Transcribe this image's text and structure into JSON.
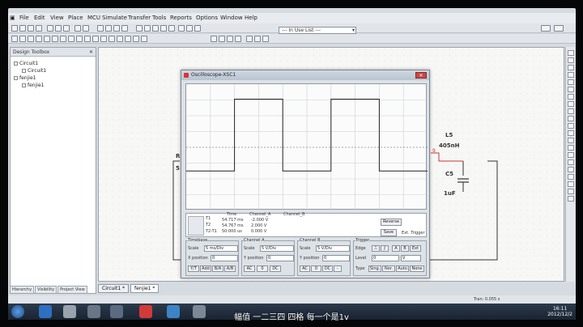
{
  "menu": [
    "File",
    "Edit",
    "View",
    "Place",
    "MCU",
    "Simulate",
    "Transfer",
    "Tools",
    "Reports",
    "Options",
    "Window",
    "Help"
  ],
  "toolbar": {
    "in_use_list": "--- In Use List ---"
  },
  "toolbox": {
    "title": "Design Toolbox",
    "tree": [
      "Circuit1",
      "Circuit1",
      "fenjie1",
      "fenjie1"
    ],
    "tabs": [
      "Hierarchy",
      "Visibility",
      "Project View"
    ]
  },
  "schematic": {
    "labels": {
      "r_label": "R",
      "r_value": "5",
      "l_label": "L5",
      "l_value": "405nH",
      "c_label": "C5",
      "c_value": "1uF",
      "node": "9"
    },
    "tabs": [
      "Circuit1 *",
      "fenjie1 *"
    ]
  },
  "status": {
    "tran": "Tran: 0.055 s"
  },
  "oscilloscope": {
    "title": "Oscilloscope-XSC1",
    "readout": {
      "headers": [
        "Time",
        "Channel_A",
        "Channel_B"
      ],
      "rows": [
        {
          "t": "T1",
          "time": "54.717 ms",
          "a": "-2.000 V"
        },
        {
          "t": "T2",
          "time": "54.767 ms",
          "a": "2.000 V"
        },
        {
          "t": "T2-T1",
          "time": "50.000 us",
          "a": "0.000 V"
        }
      ]
    },
    "buttons": {
      "reverse": "Reverse",
      "save": "Save",
      "ext_trigger": "Ext. Trigger"
    },
    "timebase": {
      "title": "Timebase",
      "scale_label": "Scale",
      "scale": "5 ms/Div",
      "xpos_label": "X position",
      "xpos": "0",
      "modes": [
        "Y/T",
        "Add",
        "B/A",
        "A/B"
      ]
    },
    "channel_a": {
      "title": "Channel A",
      "scale_label": "Scale",
      "scale": "5 V/Div",
      "ypos_label": "Y position",
      "ypos": "0",
      "coupling": [
        "AC",
        "0",
        "DC"
      ]
    },
    "channel_b": {
      "title": "Channel B",
      "scale_label": "Scale",
      "scale": "5 V/Div",
      "ypos_label": "Y position",
      "ypos": "0",
      "coupling": [
        "AC",
        "0",
        "DC",
        "-"
      ]
    },
    "trigger": {
      "title": "Trigger",
      "edge_label": "Edge",
      "level_label": "Level",
      "level": "0",
      "level_unit": "V",
      "type_label": "Type",
      "types": [
        "Sing.",
        "Nor.",
        "Auto",
        "None"
      ],
      "sources": [
        "A",
        "B",
        "Ext"
      ]
    }
  },
  "clock": {
    "time": "16:11",
    "date": "2012/12/2"
  },
  "caption": "幅值 一二三四 四格 每一个是1v",
  "colors": {
    "trace": "#222222",
    "window_bg": "#dde2e7",
    "taskbar": "#1a2433"
  }
}
